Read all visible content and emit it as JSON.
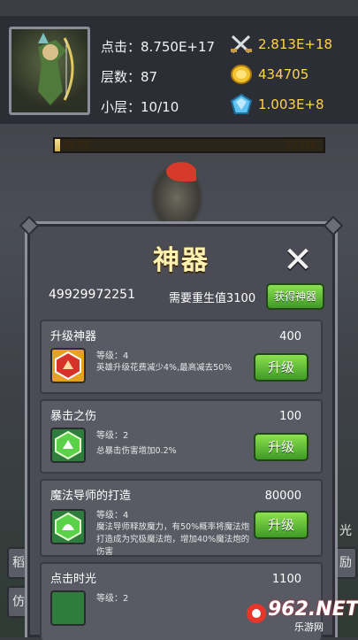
{
  "stats": {
    "click_label": "点击：",
    "click_value": "8.750E+17",
    "layer_label": "层数：",
    "layer_value": "87",
    "sublayer_label": "小层：",
    "sublayer_value": "10/10"
  },
  "resources": [
    {
      "icon": "crossed-swords-icon",
      "value": "2.813E+18"
    },
    {
      "icon": "gold-coin-icon",
      "value": "434705"
    },
    {
      "icon": "blue-gem-icon",
      "value": "1.003E+8"
    }
  ],
  "boss_bar": {
    "left": "29.95",
    "right": "22338",
    "fill_fraction": 0.02
  },
  "side_buttons": {
    "left_top": "稻",
    "left_bottom": "仿",
    "right_top": "励",
    "right_bottom": "光"
  },
  "dialog": {
    "title": "神器",
    "close_symbol": "✕",
    "rebirth_count": "49929972251",
    "rebirth_need": "需要重生值3100",
    "get_button": "获得神器",
    "cards": [
      {
        "title": "升级神器",
        "cost": "400",
        "level": "等级：4",
        "desc": "英雄升级花费减少4%,最高减去50%",
        "button": "升级"
      },
      {
        "title": "暴击之伤",
        "cost": "100",
        "level": "等级：2",
        "desc": "总暴击伤害增加0.2%",
        "button": "升级"
      },
      {
        "title": "魔法导师的打造",
        "cost": "80000",
        "level": "等级：4",
        "desc": "魔法导师释放魔力，有50%概率将魔法炮打造成为究极魔法炮，增加40%魔法炮的伤害",
        "button": "升级"
      },
      {
        "title": "点击时光",
        "cost": "1100",
        "level": "等级：2",
        "desc": "",
        "button": ""
      }
    ]
  },
  "watermark": {
    "num": "962.NET",
    "sub": "乐游网"
  },
  "colors": {
    "gold": "#ffd44a",
    "button_green": "#5cc437",
    "title_yellow": "#fff1b0"
  }
}
